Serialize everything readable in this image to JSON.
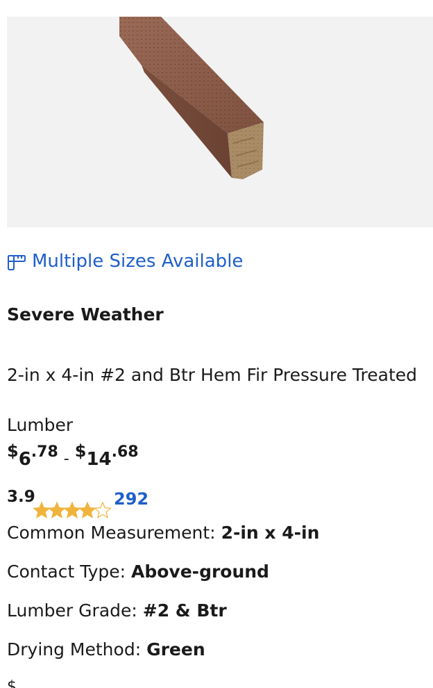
{
  "product": {
    "sizes_link_label": "Multiple Sizes Available",
    "brand": "Severe Weather",
    "title": "2-in x 4-in #2 and Btr Hem Fir Pressure Treated Lumber",
    "price": {
      "currency": "$",
      "low_dollars": "6",
      "low_cents": ".78",
      "separator": "-",
      "high_dollars": "14",
      "high_cents": ".68"
    },
    "rating": {
      "value": "3.9",
      "score": 3.9,
      "max": 5,
      "review_count": "292",
      "star_color": "#f0b43c"
    },
    "specs": [
      {
        "label": "Common Measurement:",
        "value": "2-in x 4-in"
      },
      {
        "label": "Contact Type:",
        "value": "Above-ground"
      },
      {
        "label": "Lumber Grade:",
        "value": "#2 & Btr"
      },
      {
        "label": "Drying Method:",
        "value": "Green"
      }
    ],
    "cutoff_glyph": "$"
  },
  "colors": {
    "link": "#1f5fc9",
    "text": "#1a1a1a",
    "image_bg": "#f2f2f2",
    "lumber": "#8a5c47"
  }
}
